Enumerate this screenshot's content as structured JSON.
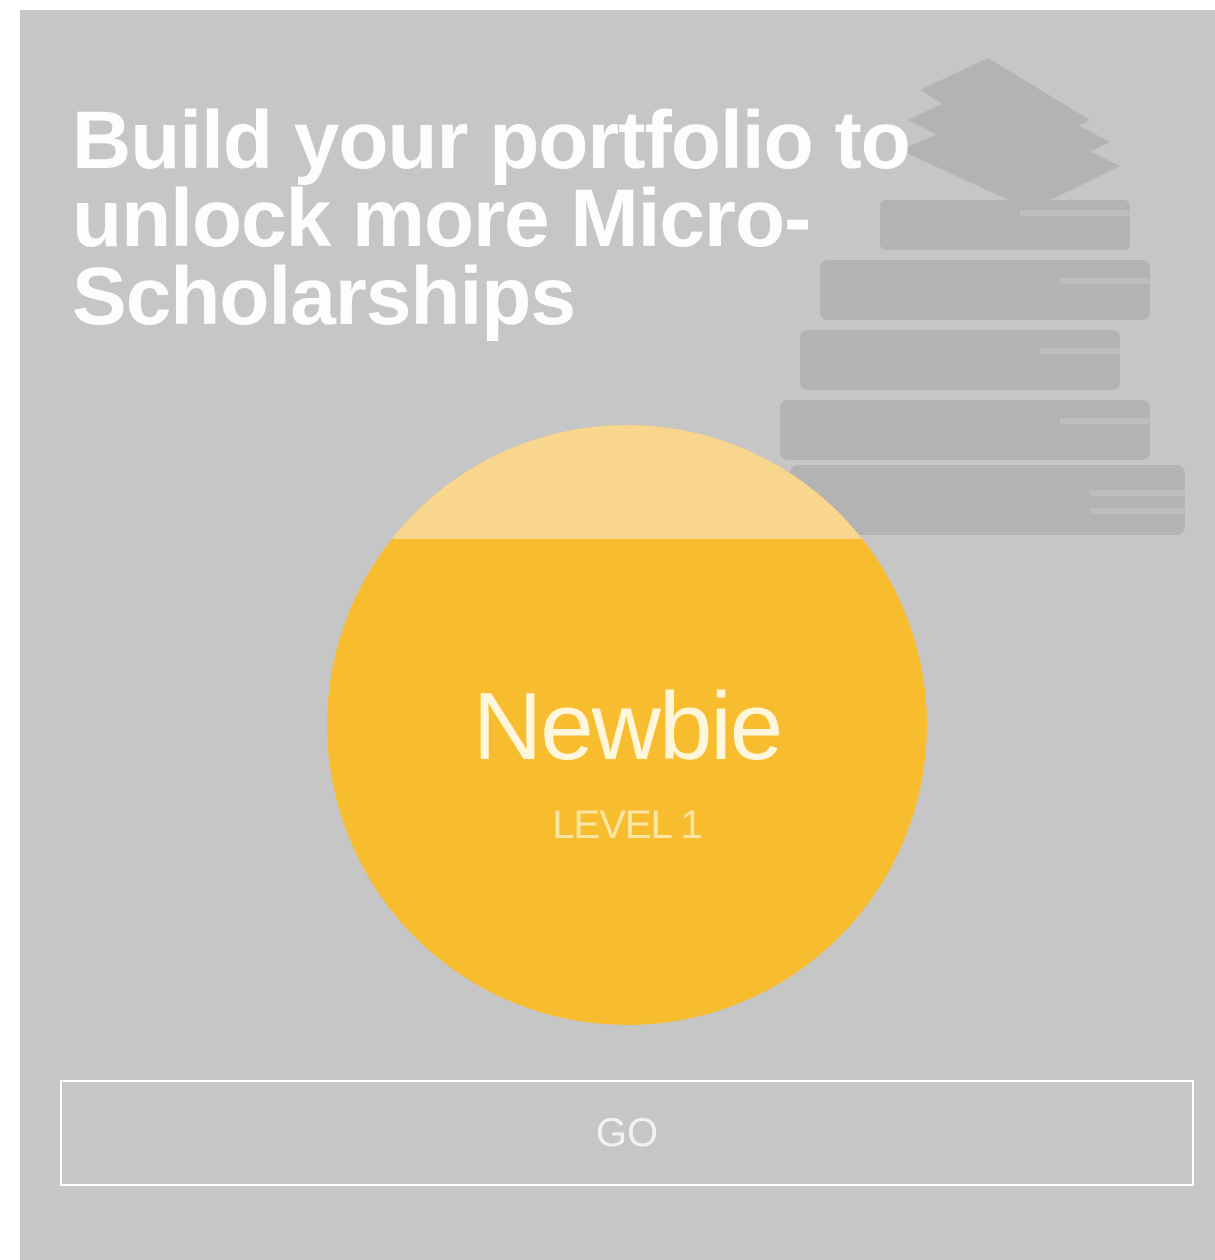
{
  "card": {
    "headline": "Build your portfolio to unlock more Micro-Scholarships",
    "background_image": "books-stack-icon"
  },
  "level": {
    "title": "Newbie",
    "subtitle": "LEVEL 1",
    "progress_fraction": 0.19,
    "colors": {
      "fill": "#f7bd2e",
      "unfilled": "#f8d68e"
    }
  },
  "actions": {
    "go_label": "GO"
  }
}
